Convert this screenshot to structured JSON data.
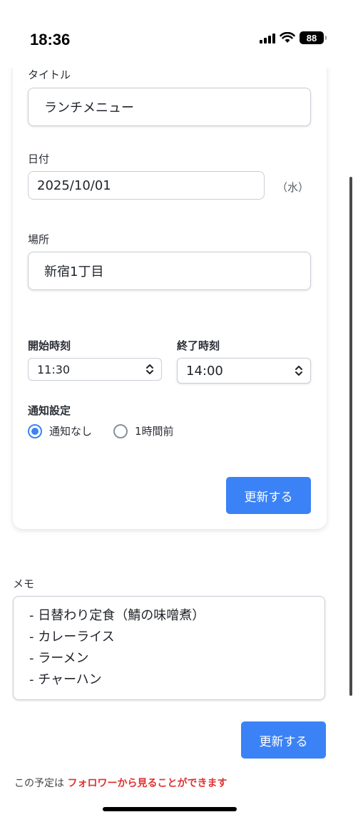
{
  "status_bar": {
    "time": "18:36",
    "battery": "88"
  },
  "form": {
    "title_label": "タイトル",
    "title_value": "ランチメニュー",
    "date_label": "日付",
    "date_value": "2025/10/01",
    "weekday": "（水）",
    "place_label": "場所",
    "place_value": "新宿1丁目",
    "start_label": "開始時刻",
    "start_value": "11:30",
    "end_label": "終了時刻",
    "end_value": "14:00",
    "notify_label": "通知設定",
    "notify_options": [
      {
        "label": "通知なし",
        "selected": true
      },
      {
        "label": "1時間前",
        "selected": false
      }
    ],
    "update_button": "更新する"
  },
  "memo": {
    "label": "メモ",
    "lines": [
      "- 日替わり定食（鯖の味噌煮）",
      "- カレーライス",
      "- ラーメン",
      "- チャーハン"
    ],
    "update_button": "更新する"
  },
  "footer": {
    "prefix": "この予定は ",
    "highlight": "フォロワーから見ることができます"
  },
  "colors": {
    "accent": "#3b82f6",
    "highlight": "#e03131"
  }
}
